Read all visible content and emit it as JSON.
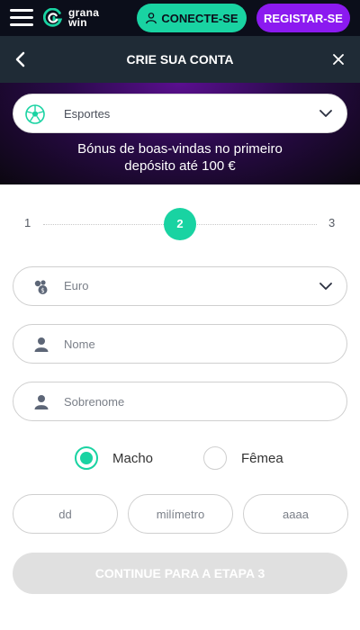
{
  "header": {
    "logo_line1": "grana",
    "logo_line2": "win",
    "connect_label": "CONECTE-SE",
    "register_label": "REGISTAR-SE"
  },
  "titlebar": {
    "title": "CRIE SUA CONTA"
  },
  "banner": {
    "sport_value": "Esportes",
    "bonus_line1": "Bónus de boas-vindas no primeiro",
    "bonus_line2": "depósito até 100 €"
  },
  "steps": {
    "step1": "1",
    "step2": "2",
    "step3": "3"
  },
  "form": {
    "currency_value": "Euro",
    "name_placeholder": "Nome",
    "surname_placeholder": "Sobrenome",
    "gender_male": "Macho",
    "gender_female": "Fêmea",
    "day_placeholder": "dd",
    "month_placeholder": "milímetro",
    "year_placeholder": "aaaa",
    "continue_label": "CONTINUE PARA A ETAPA 3"
  },
  "colors": {
    "accent_green": "#19d3a2",
    "accent_purple": "#8b1af0",
    "header_bg": "#0b0e1a",
    "titlebar_bg": "#1f2b36"
  },
  "icons": {
    "menu": "hamburger-icon",
    "connect": "user-icon",
    "back": "chevron-left-icon",
    "close": "close-icon",
    "sport": "soccer-ball-icon",
    "currency": "coins-icon",
    "person": "person-icon",
    "dropdown": "chevron-down-icon"
  }
}
